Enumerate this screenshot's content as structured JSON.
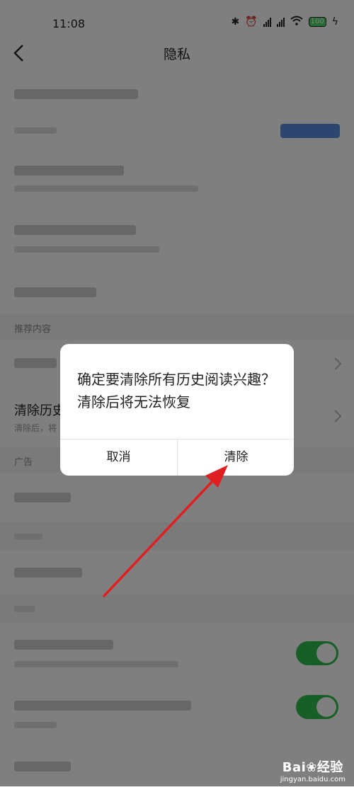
{
  "status_bar": {
    "time": "11:08",
    "battery": "100",
    "icons": [
      "bluetooth-icon",
      "alarm-icon",
      "signal-icon",
      "signal-icon",
      "wifi-icon",
      "battery-icon",
      "charging-icon"
    ]
  },
  "header": {
    "title": "隐私",
    "back_icon": "chevron-left-icon"
  },
  "list": {
    "section_recommend": "推荐内容",
    "clear_history_title": "清除历史",
    "clear_history_sub": "清除后，将",
    "section_ads": "广告"
  },
  "dialog": {
    "message": "确定要清除所有历史阅读兴趣？清除后将无法恢复",
    "cancel_label": "取消",
    "confirm_label": "清除"
  },
  "annotation": {
    "arrow_color": "#e02020"
  },
  "colors": {
    "toggle_on": "#2fbf4c",
    "overlay": "rgba(0,0,0,0.5)"
  },
  "watermark": {
    "logo": "Bai❀经验",
    "url": "jingyan.baidu.com"
  }
}
